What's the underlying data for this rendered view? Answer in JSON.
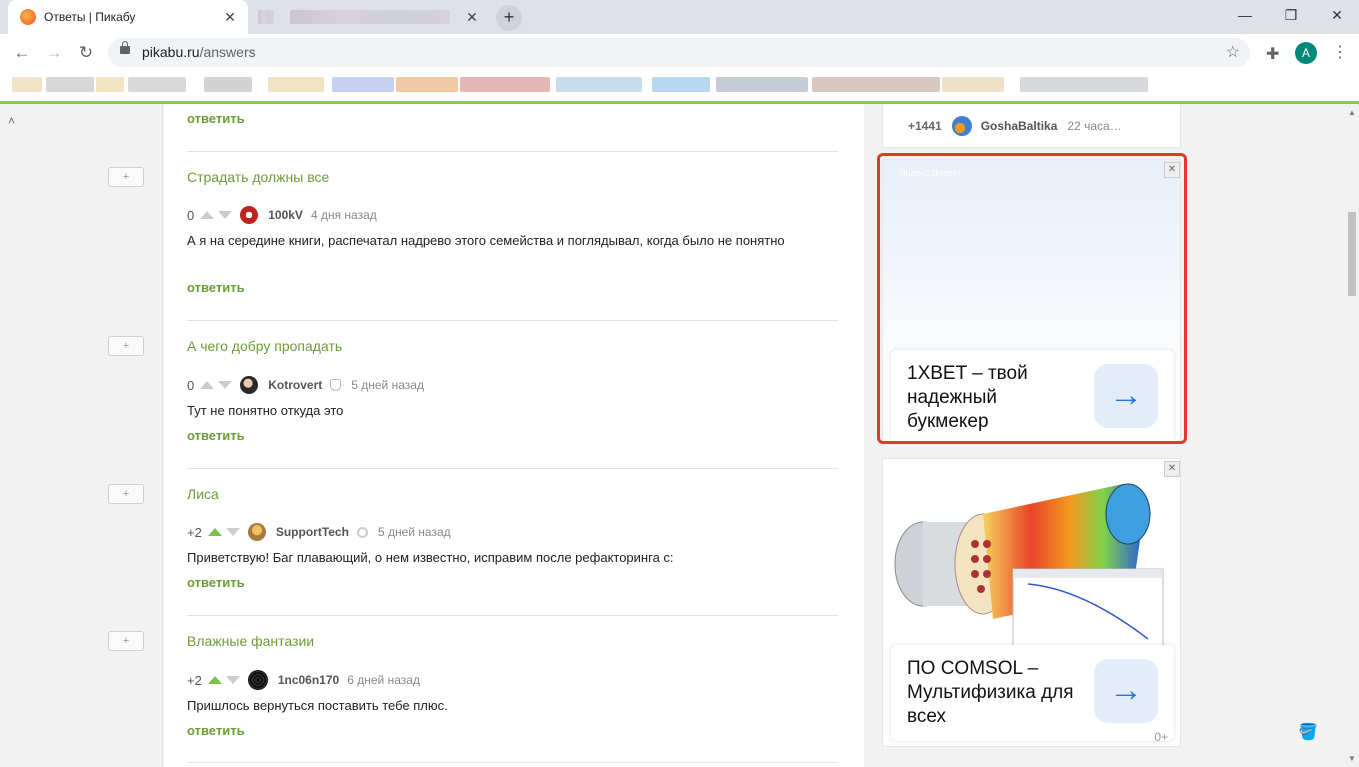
{
  "browser": {
    "tabs": [
      {
        "title": "Ответы | Пикабу",
        "active": true
      },
      {
        "title": "",
        "active": false
      }
    ],
    "new_tab_label": "+",
    "close_glyph": "✕",
    "window_controls": {
      "minimize": "—",
      "maximize": "❐",
      "close": "✕"
    },
    "url_host": "pikabu.ru",
    "url_path": "/answers",
    "profile_initial": "A"
  },
  "page": {
    "first_reply": "ответить",
    "comments": [
      {
        "story": "Страдать должны все",
        "rating": "0",
        "user": "100kV",
        "time": "4 дня назад",
        "text": "А я на середине книги, распечатал надрево этого семейства и поглядывал, когда было не понятно",
        "reply": "ответить"
      },
      {
        "story": "А чего добру пропадать",
        "rating": "0",
        "user": "Kotrovert",
        "time": "5 дней назад",
        "text": "Тут не понятно откуда это",
        "reply": "ответить"
      },
      {
        "story": "Лиса",
        "rating": "+2",
        "user": "SupportTech",
        "time": "5 дней назад",
        "text": "Приветствую! Баг плавающий, о нем известно, исправим после рефакторинга с:",
        "reply": "ответить"
      },
      {
        "story": "Влажные фантазии",
        "rating": "+2",
        "user": "1nc06n170",
        "time": "6 дней назад",
        "text": "Пришлось вернуться поставить тебе плюс.",
        "reply": "ответить"
      }
    ],
    "plus_label": "+"
  },
  "sidebar": {
    "top_card": {
      "rating": "+1441",
      "user": "GoshaBaltika",
      "time": "22 часа…"
    },
    "ad1": {
      "label": "Яндекс.Директ",
      "text": "1XBET – твой надежный букмекер",
      "close": "✕",
      "arrow": "→"
    },
    "ad2": {
      "text": "ПО COMSOL – Мультифизика для всех",
      "close": "✕",
      "arrow": "→",
      "age": "0+"
    }
  },
  "colors": {
    "accent_green": "#6a9f37",
    "highlight_red": "#e0382d",
    "ad_blue": "#1e78d7"
  }
}
